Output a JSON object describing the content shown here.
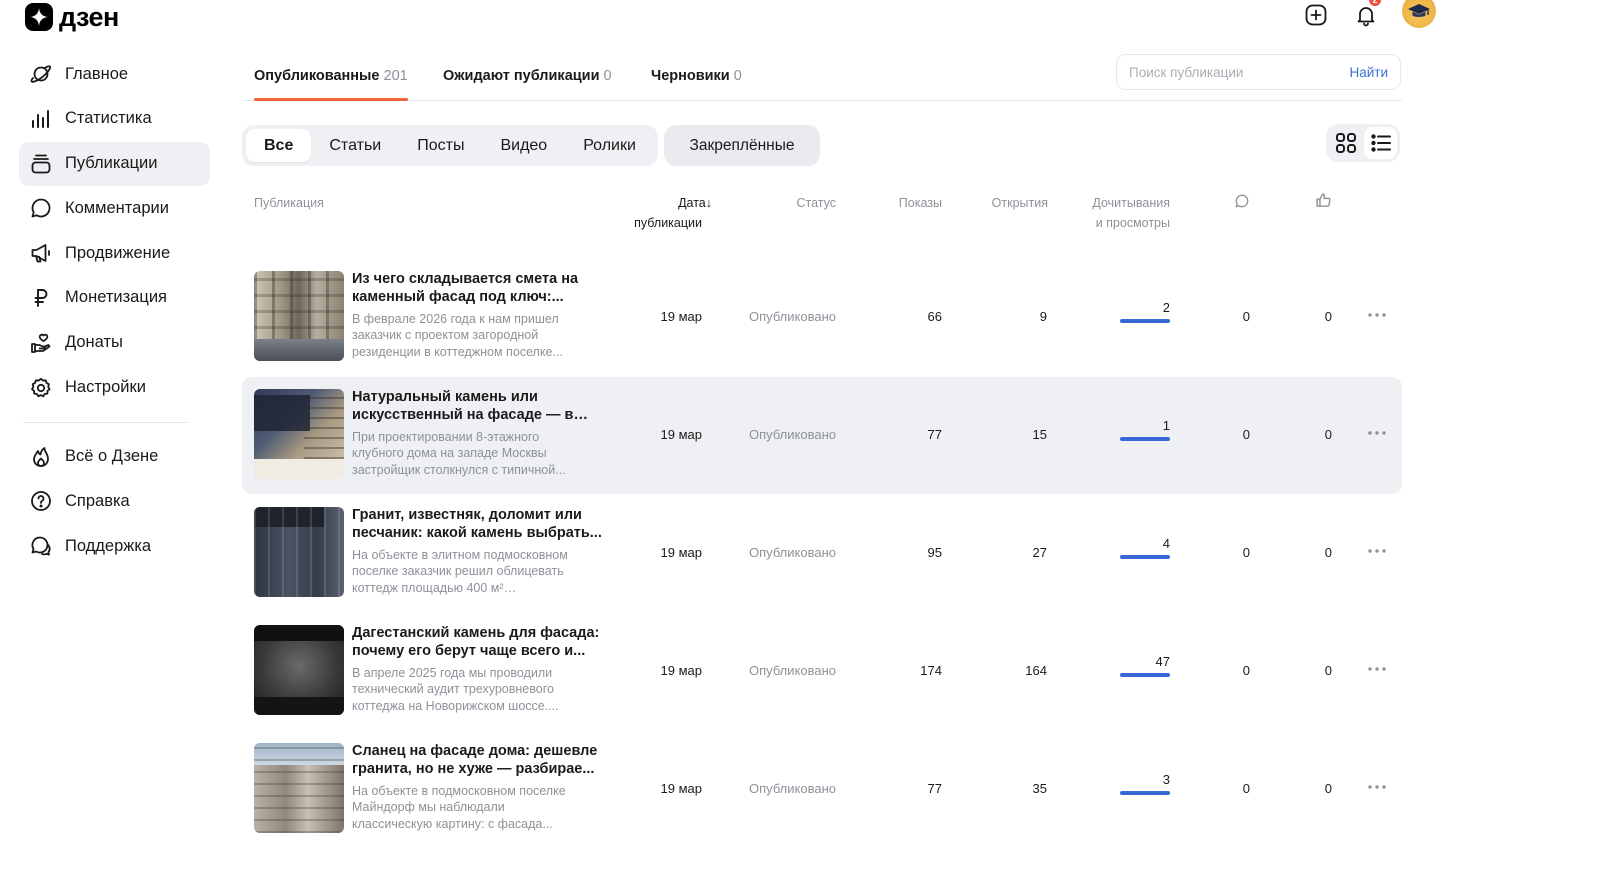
{
  "brand": {
    "name": "дзен"
  },
  "header": {
    "notifications_count": "2"
  },
  "sidebar": {
    "items": [
      {
        "label": "Главное",
        "icon": "planet-icon"
      },
      {
        "label": "Статистика",
        "icon": "bar-chart-icon"
      },
      {
        "label": "Публикации",
        "icon": "stack-icon",
        "active": true
      },
      {
        "label": "Комментарии",
        "icon": "chat-bubble-icon"
      },
      {
        "label": "Продвижение",
        "icon": "megaphone-icon"
      },
      {
        "label": "Монетизация",
        "icon": "ruble-icon"
      },
      {
        "label": "Донаты",
        "icon": "hand-heart-icon"
      },
      {
        "label": "Настройки",
        "icon": "gear-icon"
      }
    ],
    "secondary": [
      {
        "label": "Всё о Дзене",
        "icon": "flame-icon"
      },
      {
        "label": "Справка",
        "icon": "question-circle-icon"
      },
      {
        "label": "Поддержка",
        "icon": "support-chat-icon"
      }
    ]
  },
  "tabs": [
    {
      "label": "Опубликованные",
      "count": "201",
      "active": true
    },
    {
      "label": "Ожидают публикации",
      "count": "0"
    },
    {
      "label": "Черновики",
      "count": "0"
    }
  ],
  "search": {
    "placeholder": "Поиск публикации",
    "button": "Найти"
  },
  "filters": [
    "Все",
    "Статьи",
    "Посты",
    "Видео",
    "Ролики"
  ],
  "pinned_label": "Закреплённые",
  "table": {
    "headers": {
      "publication": "Публикация",
      "date_line1": "Дата",
      "date_line2": "публикации",
      "status": "Статус",
      "views": "Показы",
      "opens": "Открытия",
      "reads_line1": "Дочитывания",
      "reads_line2": "и просмотры"
    },
    "rows": [
      {
        "title": "Из чего складывается смета на каменный фасад под ключ:...",
        "desc": "В феврале 2026 года к нам пришел заказчик с проектом загородной резиденции в коттеджном поселке...",
        "date": "19 мар",
        "status": "Опубликовано",
        "views": "66",
        "opens": "9",
        "reads": "2",
        "comments": "0",
        "likes": "0"
      },
      {
        "title": "Натуральный камень или искусственный на фасаде — в чё...",
        "desc": "При проектировании 8-этажного клубного дома на западе Москвы застройщик столкнулся с типичной...",
        "date": "19 мар",
        "status": "Опубликовано",
        "views": "77",
        "opens": "15",
        "reads": "1",
        "comments": "0",
        "likes": "0"
      },
      {
        "title": "Гранит, известняк, доломит или песчаник: какой камень выбрать...",
        "desc": "На объекте в элитном подмосковном поселке заказчик решил облицевать коттедж площадью 400 м² натуральны...",
        "date": "19 мар",
        "status": "Опубликовано",
        "views": "95",
        "opens": "27",
        "reads": "4",
        "comments": "0",
        "likes": "0"
      },
      {
        "title": "Дагестанский камень для фасада: почему его берут чаще всего и...",
        "desc": "В апреле 2025 года мы проводили технический аудит трехуровневого коттеджа на Новорижском шоссе....",
        "date": "19 мар",
        "status": "Опубликовано",
        "views": "174",
        "opens": "164",
        "reads": "47",
        "comments": "0",
        "likes": "0"
      },
      {
        "title": "Сланец на фасаде дома: дешевле гранита, но не хуже — разбирае...",
        "desc": "На объекте в подмосковном поселке Майндорф мы наблюдали классическую картину: с фасада...",
        "date": "19 мар",
        "status": "Опубликовано",
        "views": "77",
        "opens": "35",
        "reads": "3",
        "comments": "0",
        "likes": "0"
      }
    ]
  }
}
